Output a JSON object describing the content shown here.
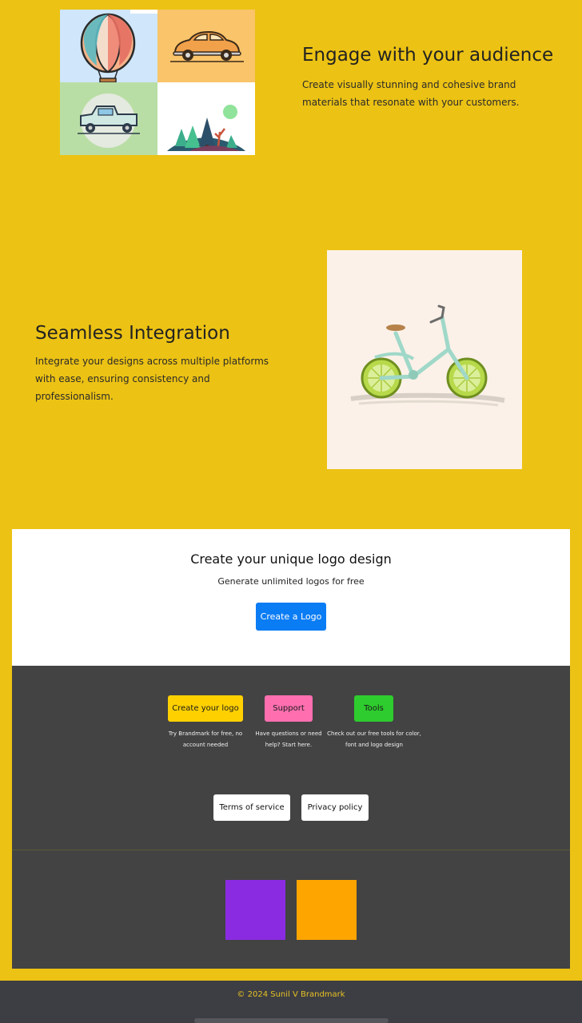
{
  "features": [
    {
      "title": "Engage with your audience",
      "description": "Create visually stunning and cohesive brand materials that resonate with your customers."
    },
    {
      "title": "Seamless Integration",
      "description": "Integrate your designs across multiple platforms with ease, ensuring consistency and professionalism."
    }
  ],
  "cta": {
    "title": "Create your unique logo design",
    "subtitle": "Generate unlimited logos for free",
    "button": "Create a Logo"
  },
  "footer": {
    "links": [
      {
        "label": "Create your logo",
        "caption": "Try Brandmark for free, no account needed",
        "color": "#ffd000"
      },
      {
        "label": "Support",
        "caption": "Have questions or need help? Start here.",
        "color": "#ff6fb0"
      },
      {
        "label": "Tools",
        "caption": "Check out our free tools for color, font and logo design",
        "color": "#2ecc2e"
      }
    ],
    "legal": [
      "Terms of service",
      "Privacy policy"
    ],
    "swatches": [
      "#8a2be2",
      "#ffa500"
    ],
    "copyright": "© 2024 Sunil V Brandmark"
  },
  "images": {
    "grid": [
      "hot-air-balloon-illustration",
      "vintage-car-illustration",
      "pickup-truck-illustration",
      "forest-landscape-illustration"
    ],
    "feature2": "lime-bicycle-illustration"
  },
  "colors": {
    "background": "#ecc214",
    "cta_button": "#0a7cf4",
    "footer_dark": "#434343"
  }
}
